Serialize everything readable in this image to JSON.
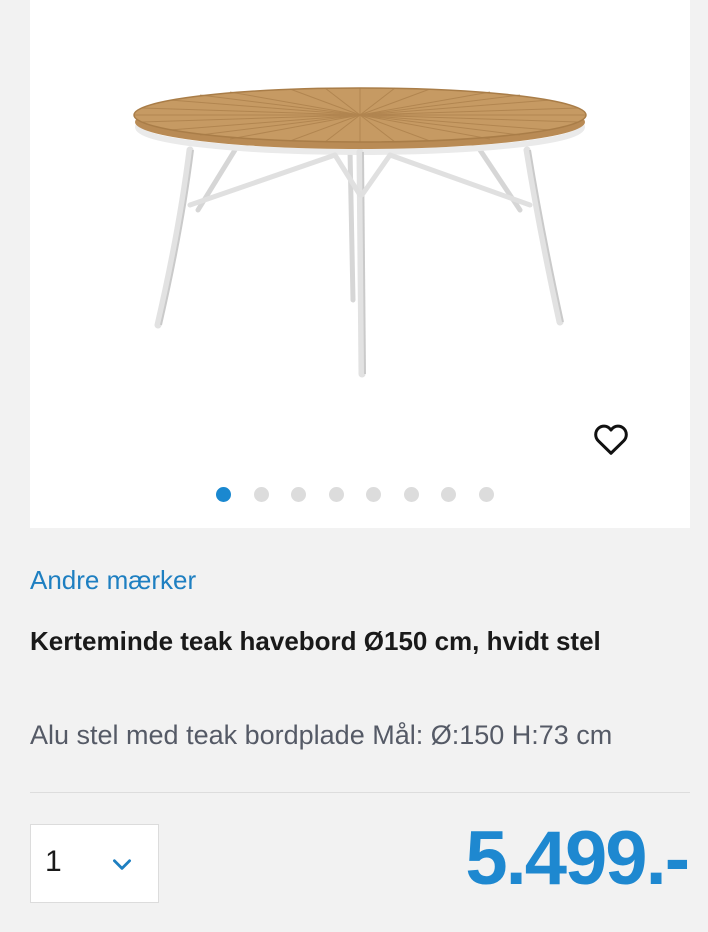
{
  "gallery": {
    "image_alt": "Kerteminde teak havebord Ø150 cm, hvidt stel",
    "image_count": 8,
    "active_index": 0,
    "favorite_icon": "heart-outline-icon"
  },
  "product": {
    "brand": "Andre mærker",
    "title": "Kerteminde teak havebord Ø150 cm, hvidt stel",
    "description": "Alu stel med teak bordplade Mål: Ø:150 H:73 cm",
    "price": "5.499.-"
  },
  "quantity": {
    "selected": "1",
    "chevron_icon": "chevron-down-icon"
  },
  "colors": {
    "accent": "#1e88d0",
    "link": "#1e7fc1",
    "dot_inactive": "#dcdcdc"
  }
}
